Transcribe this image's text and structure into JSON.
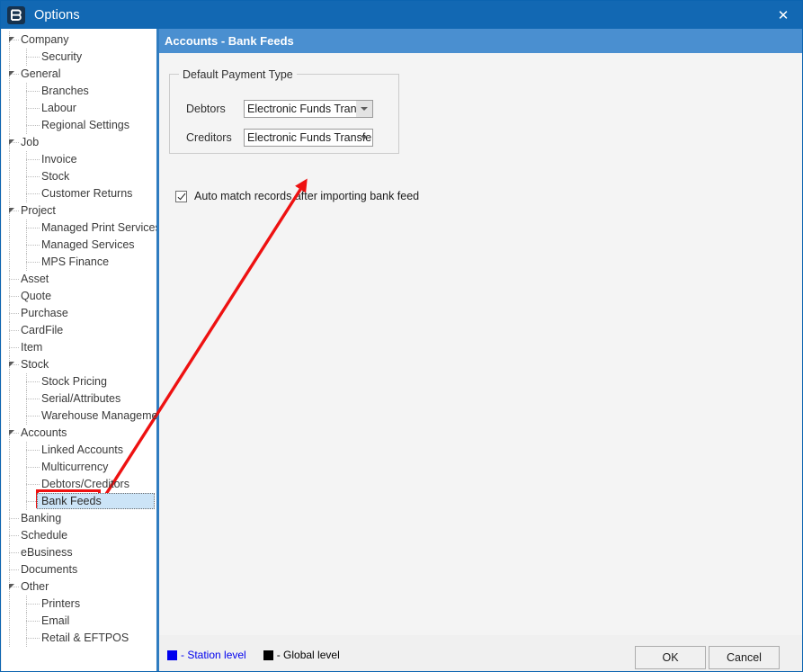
{
  "window": {
    "title": "Options",
    "app_icon": "options-app-icon",
    "close_label": "✕"
  },
  "tree": {
    "name": "options-category-tree",
    "selected": "Bank Feeds",
    "items": [
      {
        "label": "Company",
        "level": 1,
        "expanded": true
      },
      {
        "label": "Security",
        "level": 2,
        "expanded": false
      },
      {
        "label": "General",
        "level": 1,
        "expanded": true
      },
      {
        "label": "Branches",
        "level": 2,
        "expanded": false
      },
      {
        "label": "Labour",
        "level": 2,
        "expanded": false
      },
      {
        "label": "Regional Settings",
        "level": 2,
        "expanded": false
      },
      {
        "label": "Job",
        "level": 1,
        "expanded": true
      },
      {
        "label": "Invoice",
        "level": 2,
        "expanded": false
      },
      {
        "label": "Stock",
        "level": 2,
        "expanded": false
      },
      {
        "label": "Customer Returns",
        "level": 2,
        "expanded": false
      },
      {
        "label": "Project",
        "level": 1,
        "expanded": true
      },
      {
        "label": "Managed Print Services",
        "level": 2,
        "expanded": false
      },
      {
        "label": "Managed Services",
        "level": 2,
        "expanded": false
      },
      {
        "label": "MPS Finance",
        "level": 2,
        "expanded": false
      },
      {
        "label": "Asset",
        "level": 1,
        "expanded": false
      },
      {
        "label": "Quote",
        "level": 1,
        "expanded": false
      },
      {
        "label": "Purchase",
        "level": 1,
        "expanded": false
      },
      {
        "label": "CardFile",
        "level": 1,
        "expanded": false
      },
      {
        "label": "Item",
        "level": 1,
        "expanded": false
      },
      {
        "label": "Stock",
        "level": 1,
        "expanded": true
      },
      {
        "label": "Stock Pricing",
        "level": 2,
        "expanded": false
      },
      {
        "label": "Serial/Attributes",
        "level": 2,
        "expanded": false
      },
      {
        "label": "Warehouse Management",
        "level": 2,
        "expanded": false
      },
      {
        "label": "Accounts",
        "level": 1,
        "expanded": true
      },
      {
        "label": "Linked Accounts",
        "level": 2,
        "expanded": false
      },
      {
        "label": "Multicurrency",
        "level": 2,
        "expanded": false
      },
      {
        "label": "Debtors/Creditors",
        "level": 2,
        "expanded": false
      },
      {
        "label": "Bank Feeds",
        "level": 2,
        "expanded": false,
        "selected": true
      },
      {
        "label": "Banking",
        "level": 1,
        "expanded": false
      },
      {
        "label": "Schedule",
        "level": 1,
        "expanded": false
      },
      {
        "label": "eBusiness",
        "level": 1,
        "expanded": false
      },
      {
        "label": "Documents",
        "level": 1,
        "expanded": false
      },
      {
        "label": "Other",
        "level": 1,
        "expanded": true
      },
      {
        "label": "Printers",
        "level": 2,
        "expanded": false
      },
      {
        "label": "Email",
        "level": 2,
        "expanded": false
      },
      {
        "label": "Retail & EFTPOS",
        "level": 2,
        "expanded": false
      }
    ]
  },
  "content": {
    "header": "Accounts - Bank Feeds",
    "group": {
      "legend": "Default Payment Type",
      "fields": [
        {
          "label": "Debtors",
          "value": "Electronic Funds Transfer",
          "focused": true
        },
        {
          "label": "Creditors",
          "value": "Electronic Funds Transfer",
          "focused": false
        }
      ]
    },
    "checkbox": {
      "label": "Auto match records after importing bank feed",
      "checked": true
    }
  },
  "footer": {
    "legend": [
      {
        "swatch": "#0000ee",
        "text": "- Station level",
        "text_color": "#0000ee"
      },
      {
        "swatch": "#000000",
        "text": "- Global level",
        "text_color": "#000000"
      }
    ],
    "ok_label": "OK",
    "cancel_label": "Cancel"
  },
  "annotation": {
    "arrow_color": "#ee1111",
    "highlight_color": "#ee1111",
    "highlight_target": "Bank Feeds"
  }
}
